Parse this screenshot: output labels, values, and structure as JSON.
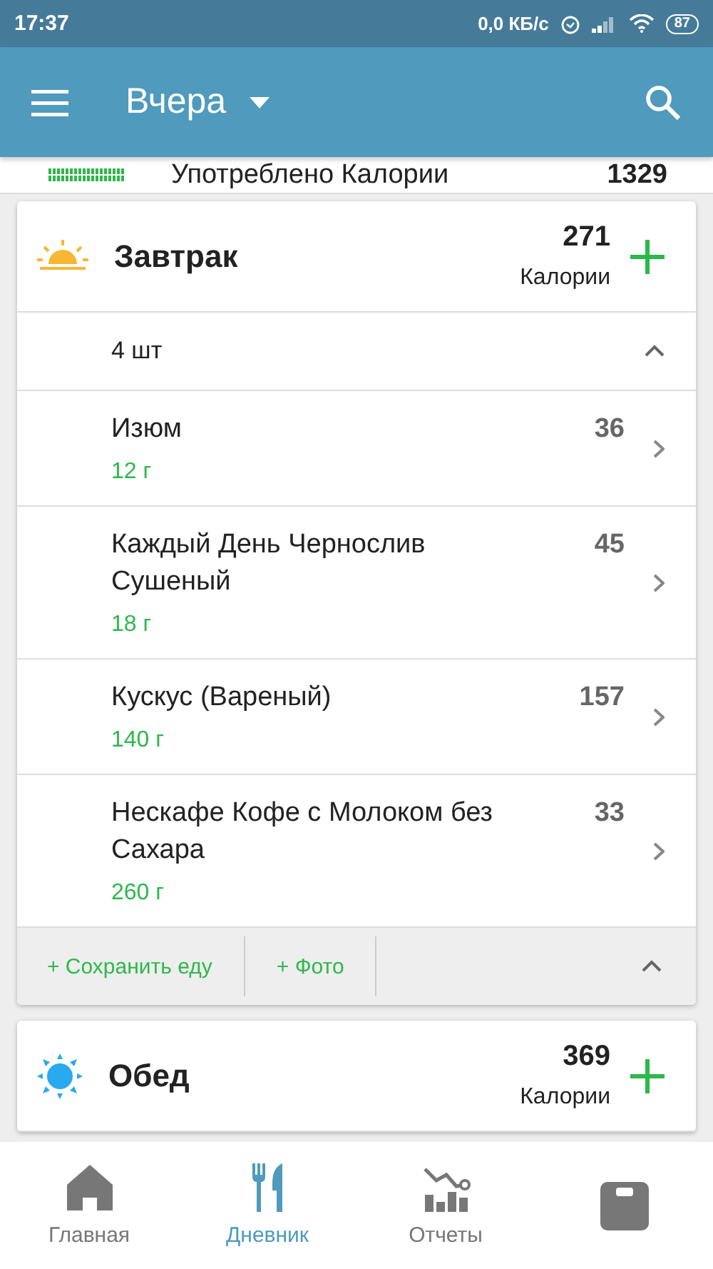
{
  "status_bar": {
    "time": "17:37",
    "speed": "0,0 КБ/с",
    "battery": "87"
  },
  "app_bar": {
    "title": "Вчера"
  },
  "summary": {
    "label": "Употреблено Калории",
    "value": "1329"
  },
  "meals": [
    {
      "kind": "sunrise",
      "name": "Завтрак",
      "calories": "271",
      "calories_label": "Калории",
      "expanded": true,
      "count": "4 шт",
      "items": [
        {
          "name": "Изюм",
          "amount": "12 г",
          "calories": "36"
        },
        {
          "name": "Каждый День Чернослив Сушеный",
          "amount": "18 г",
          "calories": "45"
        },
        {
          "name": "Кускус (Вареный)",
          "amount": "140  г",
          "calories": "157"
        },
        {
          "name": "Нескафе Кофе с Молоком без Сахара",
          "amount": "260  г",
          "calories": "33"
        }
      ],
      "actions": [
        "+ Сохранить еду",
        "+ Фото"
      ]
    },
    {
      "kind": "sun",
      "name": "Обед",
      "calories": "369",
      "calories_label": "Калории"
    }
  ],
  "nav": [
    {
      "kind": "home",
      "label": "Главная",
      "selected": false
    },
    {
      "kind": "diary",
      "label": "Дневник",
      "selected": true
    },
    {
      "kind": "reports",
      "label": "Отчеты",
      "selected": false
    },
    {
      "kind": "scale",
      "selected": false
    }
  ]
}
